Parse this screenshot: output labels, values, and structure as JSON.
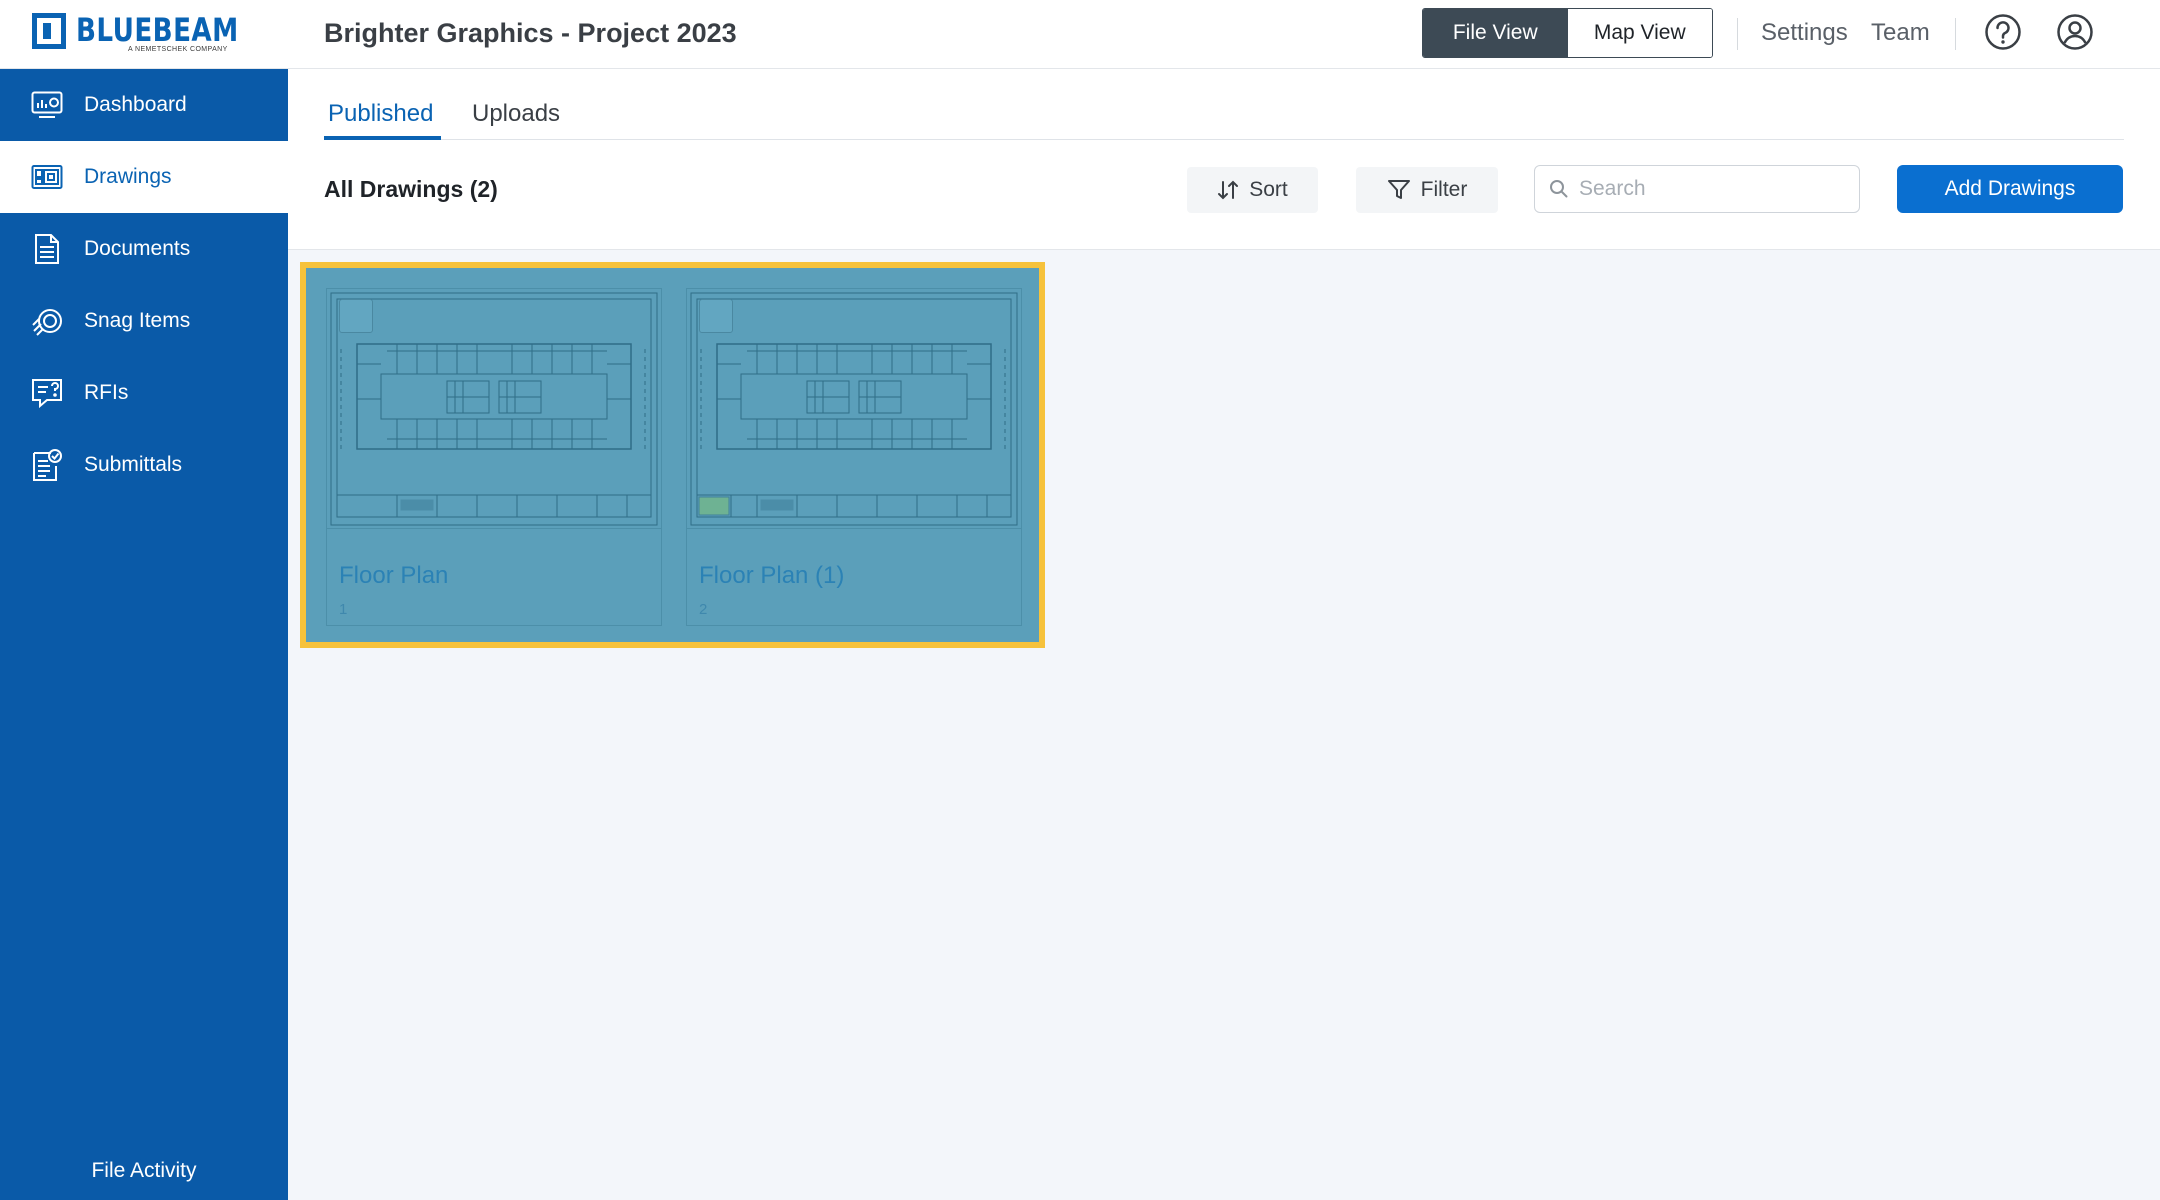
{
  "brand": {
    "name": "BLUEBEAM",
    "tagline": "A NEMETSCHEK COMPANY",
    "color": "#0a63b3"
  },
  "header": {
    "project_title": "Brighter Graphics - Project 2023",
    "view_toggle": [
      {
        "label": "File View",
        "active": true
      },
      {
        "label": "Map View",
        "active": false
      }
    ],
    "links": {
      "settings": "Settings",
      "team": "Team"
    },
    "icons": [
      "help-icon",
      "user-account-icon"
    ]
  },
  "sidebar": {
    "items": [
      {
        "label": "Dashboard",
        "icon": "dashboard-icon",
        "active": false
      },
      {
        "label": "Drawings",
        "icon": "drawings-icon",
        "active": true
      },
      {
        "label": "Documents",
        "icon": "documents-icon",
        "active": false
      },
      {
        "label": "Snag Items",
        "icon": "snag-items-icon",
        "active": false
      },
      {
        "label": "RFIs",
        "icon": "rfis-icon",
        "active": false
      },
      {
        "label": "Submittals",
        "icon": "submittals-icon",
        "active": false
      }
    ],
    "footer": "File Activity",
    "bg_color": "#0a5aa8"
  },
  "main": {
    "tabs": [
      {
        "label": "Published",
        "active": true
      },
      {
        "label": "Uploads",
        "active": false
      }
    ],
    "section_title": "All Drawings (2)",
    "toolbar": {
      "sort_label": "Sort",
      "filter_label": "Filter",
      "search_placeholder": "Search",
      "search_value": "",
      "add_label": "Add Drawings"
    },
    "drawings": [
      {
        "title": "Floor Plan",
        "number": "1"
      },
      {
        "title": "Floor Plan (1)",
        "number": "2"
      }
    ],
    "highlight_color": "#f6c23b",
    "accent_color": "#0a6fd0"
  }
}
